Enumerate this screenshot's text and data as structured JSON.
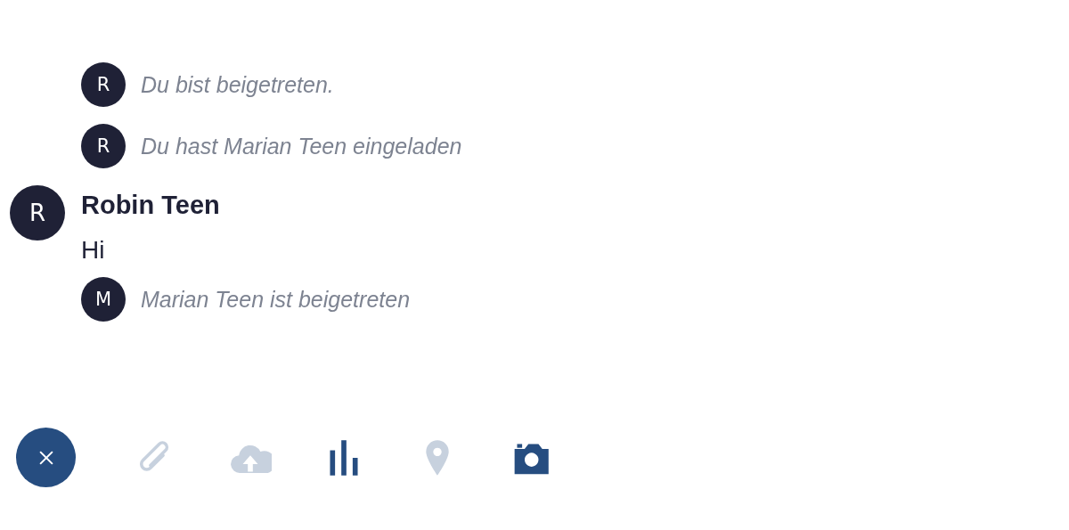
{
  "timeline": [
    {
      "kind": "event",
      "avatar": "R",
      "text": "Du bist beigetreten."
    },
    {
      "kind": "event",
      "avatar": "R",
      "text": "Du hast Marian Teen eingeladen"
    },
    {
      "kind": "message",
      "avatar": "R",
      "sender": "Robin Teen",
      "text": "Hi"
    },
    {
      "kind": "event",
      "avatar": "M",
      "text": "Marian Teen ist beigetreten"
    }
  ],
  "toolbar": [
    {
      "kind": "attachment",
      "disabled": true
    },
    {
      "kind": "upload",
      "disabled": true
    },
    {
      "kind": "poll",
      "disabled": false
    },
    {
      "kind": "location",
      "disabled": true
    },
    {
      "kind": "camera",
      "disabled": false
    }
  ]
}
